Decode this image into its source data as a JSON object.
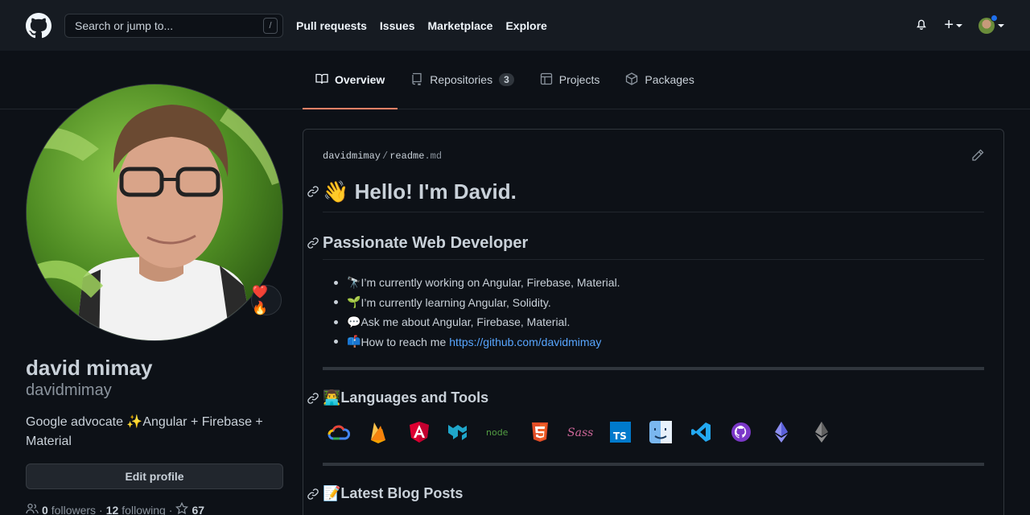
{
  "header": {
    "search_placeholder": "Search or jump to...",
    "search_shortcut": "/",
    "nav": [
      "Pull requests",
      "Issues",
      "Marketplace",
      "Explore"
    ],
    "plus_label": "+"
  },
  "tabs": [
    {
      "label": "Overview",
      "active": true
    },
    {
      "label": "Repositories",
      "count": "3"
    },
    {
      "label": "Projects"
    },
    {
      "label": "Packages"
    }
  ],
  "profile": {
    "status_emoji": "❤️🔥",
    "name": "david mimay",
    "username": "davidmimay",
    "bio": "Google advocate ✨Angular + Firebase + Material",
    "edit_button": "Edit profile",
    "followers_count": "0",
    "followers_label": "followers",
    "separator": "·",
    "following_count": "12",
    "following_label": "following",
    "stars_separator": "·",
    "stars_count": "67"
  },
  "readme": {
    "owner": "davidmimay",
    "path_sep": "/",
    "file_name": "readme",
    "file_ext": ".md",
    "heading": "👋 Hello! I'm David.",
    "subheading": "Passionate Web Developer",
    "bullets": [
      {
        "emoji": "🔭",
        "text": "I’m currently working on Angular, Firebase, Material."
      },
      {
        "emoji": "🌱",
        "text": "I’m currently learning Angular, Solidity."
      },
      {
        "emoji": "💬",
        "text": "Ask me about Angular, Firebase, Material."
      },
      {
        "emoji": "📫",
        "text": "How to reach me",
        "link": "https://github.com/davidmimay"
      }
    ],
    "tools_heading": "👨‍💻Languages and Tools",
    "tools": [
      "google-cloud",
      "firebase",
      "angular",
      "material-ui",
      "nodejs",
      "html5",
      "sass",
      "typescript",
      "finder",
      "vscode",
      "github",
      "ethereum",
      "ethereum-gray"
    ],
    "blog_heading": "📝Latest Blog Posts"
  }
}
